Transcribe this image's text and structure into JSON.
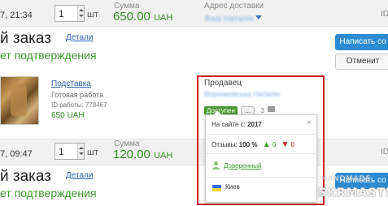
{
  "order1": {
    "date": "7, 21:34",
    "qty": "1",
    "qty_unit": "шт",
    "sum_label": "Сумма",
    "sum_value": "650.00",
    "sum_currency": "UAH",
    "addr_label": "Адрес доставки",
    "addr_name": "Ваш Наталія",
    "id_label": "ID",
    "title": "й заказ",
    "details": "Детали",
    "status": "ет подтверждения",
    "btn_write": "Написать со",
    "btn_cancel": "Отменит"
  },
  "product": {
    "name": "Подставка",
    "state": "Готовая работа",
    "work_id": "ID работы: 778467",
    "price": "650 UAH"
  },
  "seller": {
    "label": "Продавец",
    "name": "Воронковська Наталія",
    "badge": "Доступен",
    "dots": "...",
    "count": "3"
  },
  "popup": {
    "since_label": "На сайте с:",
    "since_value": "2017",
    "close": "×",
    "reviews_label": "Отзывы:",
    "reviews_pct": "100 %",
    "likes": "0",
    "dislikes": "0",
    "trusted": "Доверенный",
    "city": "Киев"
  },
  "order2": {
    "date": "7, 09:47",
    "qty": "1",
    "qty_unit": "шт",
    "sum_label": "Сумма",
    "sum_value": "120.00",
    "sum_currency": "UAH",
    "id_label": "ID",
    "title": "й заказ",
    "details": "Детали",
    "status": "ет подтверждения",
    "btn_write": "Написать со"
  },
  "watermark": {
    "line1": "HANDMADE",
    "line2": "SKRMASTER"
  },
  "colors": {
    "accent_blue": "#2c8bd1",
    "price_green": "#2f8f1f",
    "highlight_red": "#d21f26"
  }
}
